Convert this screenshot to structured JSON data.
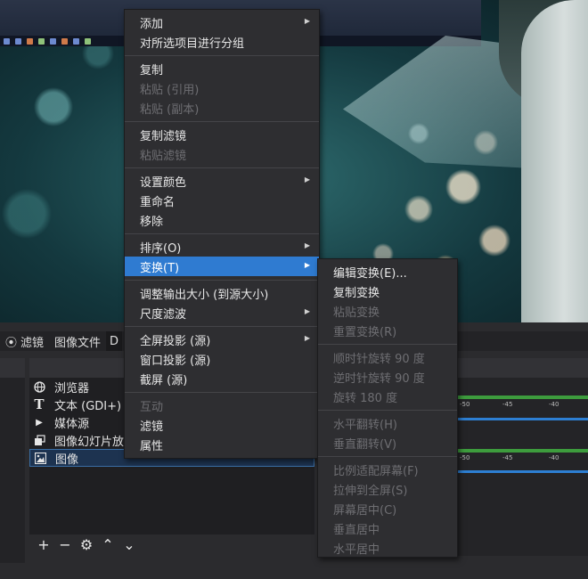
{
  "docks": {
    "tabs": [
      {
        "label": "滤镜",
        "icon": "filter-icon"
      },
      {
        "label": "图像文件"
      },
      {
        "label": "D"
      }
    ],
    "sources": [
      {
        "label": "浏览器",
        "icon": "globe-icon"
      },
      {
        "label": "文本 (GDI+)",
        "icon": "text-icon"
      },
      {
        "label": "媒体源",
        "icon": "play-icon"
      },
      {
        "label": "图像幻灯片放",
        "icon": "slideshow-icon"
      },
      {
        "label": "图像",
        "icon": "image-icon",
        "selected": true
      }
    ],
    "toolbar": {
      "add": "+",
      "remove": "−",
      "settings": "⚙",
      "up": "⌃",
      "down": "⌄"
    },
    "meter_scale": [
      "-50",
      "-45",
      "-40"
    ]
  },
  "context_menu": {
    "groups": [
      [
        {
          "label": "添加",
          "submenu": true
        },
        {
          "label": "对所选项目进行分组"
        }
      ],
      [
        {
          "label": "复制"
        },
        {
          "label": "粘贴 (引用)",
          "disabled": true
        },
        {
          "label": "粘贴 (副本)",
          "disabled": true
        }
      ],
      [
        {
          "label": "复制滤镜"
        },
        {
          "label": "粘贴滤镜",
          "disabled": true
        }
      ],
      [
        {
          "label": "设置颜色",
          "submenu": true
        },
        {
          "label": "重命名"
        },
        {
          "label": "移除"
        }
      ],
      [
        {
          "label": "排序(O)",
          "submenu": true
        },
        {
          "label": "变换(T)",
          "submenu": true,
          "highlighted": true
        }
      ],
      [
        {
          "label": "调整输出大小 (到源大小)"
        },
        {
          "label": "尺度滤波",
          "submenu": true
        }
      ],
      [
        {
          "label": "全屏投影 (源)",
          "submenu": true
        },
        {
          "label": "窗口投影 (源)"
        },
        {
          "label": "截屏 (源)"
        }
      ],
      [
        {
          "label": "互动",
          "disabled": true
        },
        {
          "label": "滤镜"
        },
        {
          "label": "属性"
        }
      ]
    ]
  },
  "transform_submenu": {
    "groups": [
      [
        {
          "label": "编辑变换(E)..."
        },
        {
          "label": "复制变换"
        },
        {
          "label": "粘贴变换",
          "disabled": true
        },
        {
          "label": "重置变换(R)",
          "disabled": true
        }
      ],
      [
        {
          "label": "顺时针旋转 90 度",
          "disabled": true
        },
        {
          "label": "逆时针旋转 90 度",
          "disabled": true
        },
        {
          "label": "旋转 180 度",
          "disabled": true
        }
      ],
      [
        {
          "label": "水平翻转(H)",
          "disabled": true
        },
        {
          "label": "垂直翻转(V)",
          "disabled": true
        }
      ],
      [
        {
          "label": "比例适配屏幕(F)",
          "disabled": true
        },
        {
          "label": "拉伸到全屏(S)",
          "disabled": true
        },
        {
          "label": "屏幕居中(C)",
          "disabled": true
        },
        {
          "label": "垂直居中",
          "disabled": true
        },
        {
          "label": "水平居中",
          "disabled": true
        }
      ]
    ]
  }
}
